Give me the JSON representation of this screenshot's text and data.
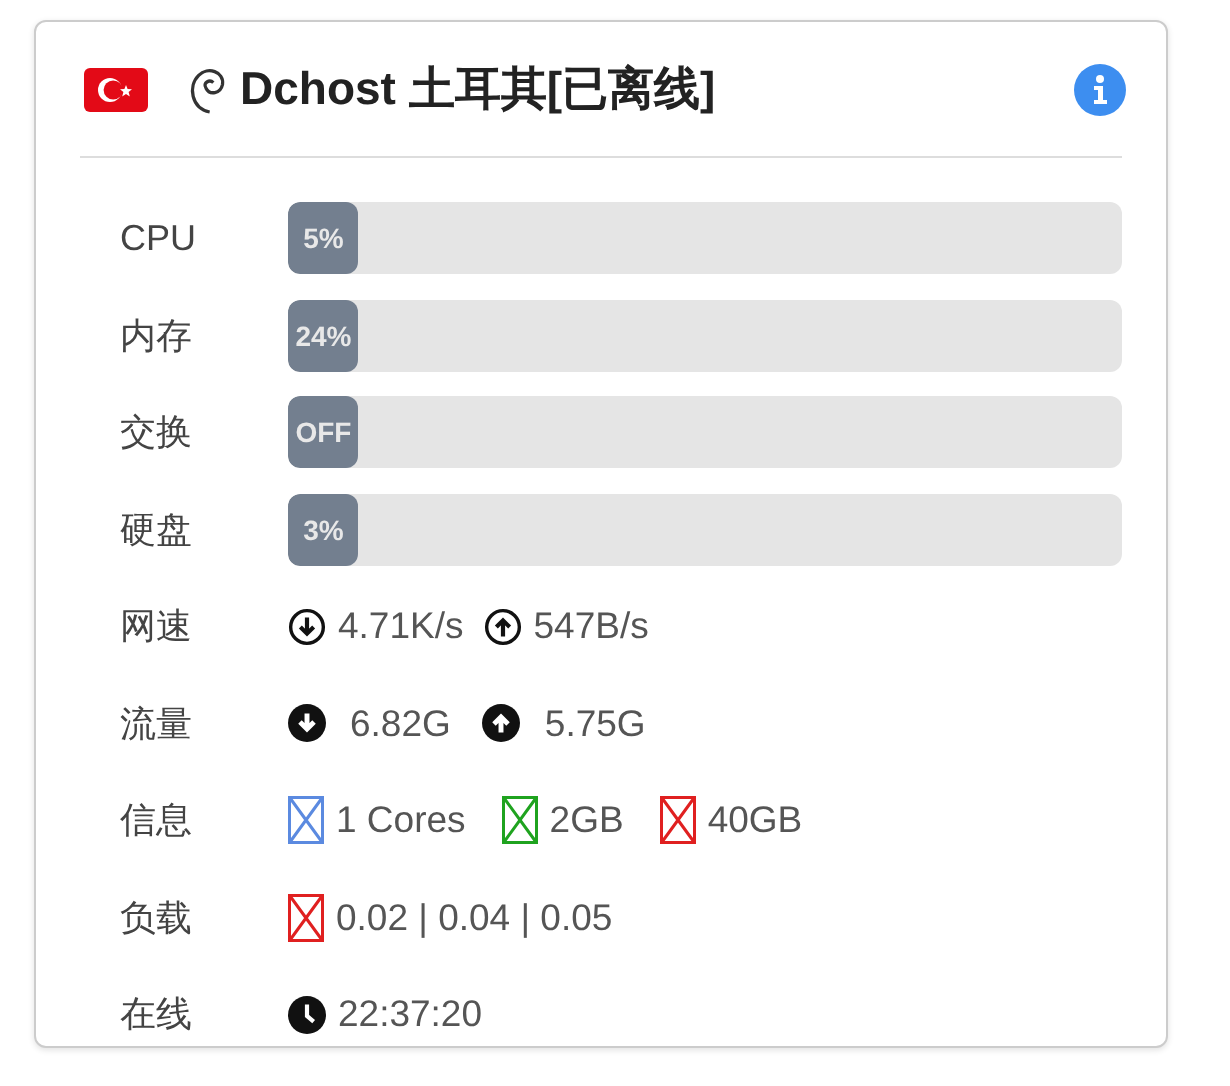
{
  "title": "Dchost 土耳其[已离线]",
  "bars": [
    {
      "label": "CPU",
      "text": "5%",
      "level": 0.085
    },
    {
      "label": "内存",
      "text": "24%",
      "level": 0.085
    },
    {
      "label": "交换",
      "text": "OFF",
      "level": 0.085
    },
    {
      "label": "硬盘",
      "text": "3%",
      "level": 0.085
    }
  ],
  "speed": {
    "label": "网速",
    "down": "4.71K/s",
    "up": "547B/s"
  },
  "traffic": {
    "label": "流量",
    "down": "6.82G",
    "up": "5.75G"
  },
  "info": {
    "label": "信息",
    "items": [
      {
        "text": "1 Cores",
        "color": "#5b8ae0"
      },
      {
        "text": "2GB",
        "color": "#1fa31f"
      },
      {
        "text": "40GB",
        "color": "#e02020"
      }
    ]
  },
  "load": {
    "label": "负载",
    "items": [
      {
        "text": "0.02 | 0.04 | 0.05",
        "color": "#e02020"
      }
    ]
  },
  "online": {
    "label": "在线",
    "time": "22:37:20"
  }
}
